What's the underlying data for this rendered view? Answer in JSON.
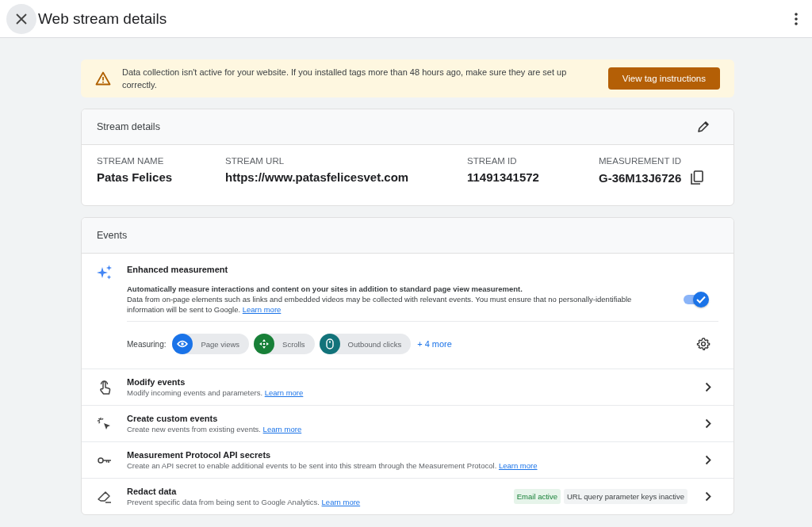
{
  "header": {
    "title": "Web stream details"
  },
  "banner": {
    "message": "Data collection isn't active for your website. If you installed tags more than 48 hours ago, make sure they are set up correctly.",
    "button": "View tag instructions"
  },
  "stream_details": {
    "title": "Stream details",
    "fields": [
      {
        "label": "STREAM NAME",
        "value": "Patas Felices"
      },
      {
        "label": "STREAM URL",
        "value": "https://www.patasfelicesvet.com"
      },
      {
        "label": "STREAM ID",
        "value": "11491341572"
      },
      {
        "label": "MEASUREMENT ID",
        "value": "G-36M13J6726"
      }
    ]
  },
  "events": {
    "title": "Events",
    "enhanced": {
      "title": "Enhanced measurement",
      "lead": "Automatically measure interactions and content on your sites in addition to standard page view measurement.",
      "body": "Data from on-page elements such as links and embedded videos may be collected with relevant events. You must ensure that no personally-identifiable information will be sent to Google.",
      "link": "Learn more",
      "on": true,
      "measuring_label": "Measuring:",
      "chips": [
        {
          "kind": "eye",
          "label": "Page views",
          "color": "#1a73e8"
        },
        {
          "kind": "scroll",
          "label": "Scrolls",
          "color": "#188038"
        },
        {
          "kind": "mouse",
          "label": "Outbound clicks",
          "color": "#12737a"
        }
      ],
      "more": "+ 4 more"
    },
    "rows": [
      {
        "kind": "touch",
        "title": "Modify events",
        "desc": "Modify incoming events and parameters.",
        "link": "Learn more",
        "badges": []
      },
      {
        "kind": "sparkle-cursor",
        "title": "Create custom events",
        "desc": "Create new events from existing events.",
        "link": "Learn more",
        "badges": []
      },
      {
        "kind": "key",
        "title": "Measurement Protocol API secrets",
        "desc": "Create an API secret to enable additional events to be sent into this stream through the Measurement Protocol.",
        "link": "Learn more",
        "badges": []
      },
      {
        "kind": "eraser",
        "title": "Redact data",
        "desc": "Prevent specific data from being sent to Google Analytics.",
        "link": "Learn more",
        "badges": [
          {
            "label": "Email active",
            "active": true
          },
          {
            "label": "URL query parameter keys inactive",
            "active": false
          }
        ]
      }
    ]
  }
}
